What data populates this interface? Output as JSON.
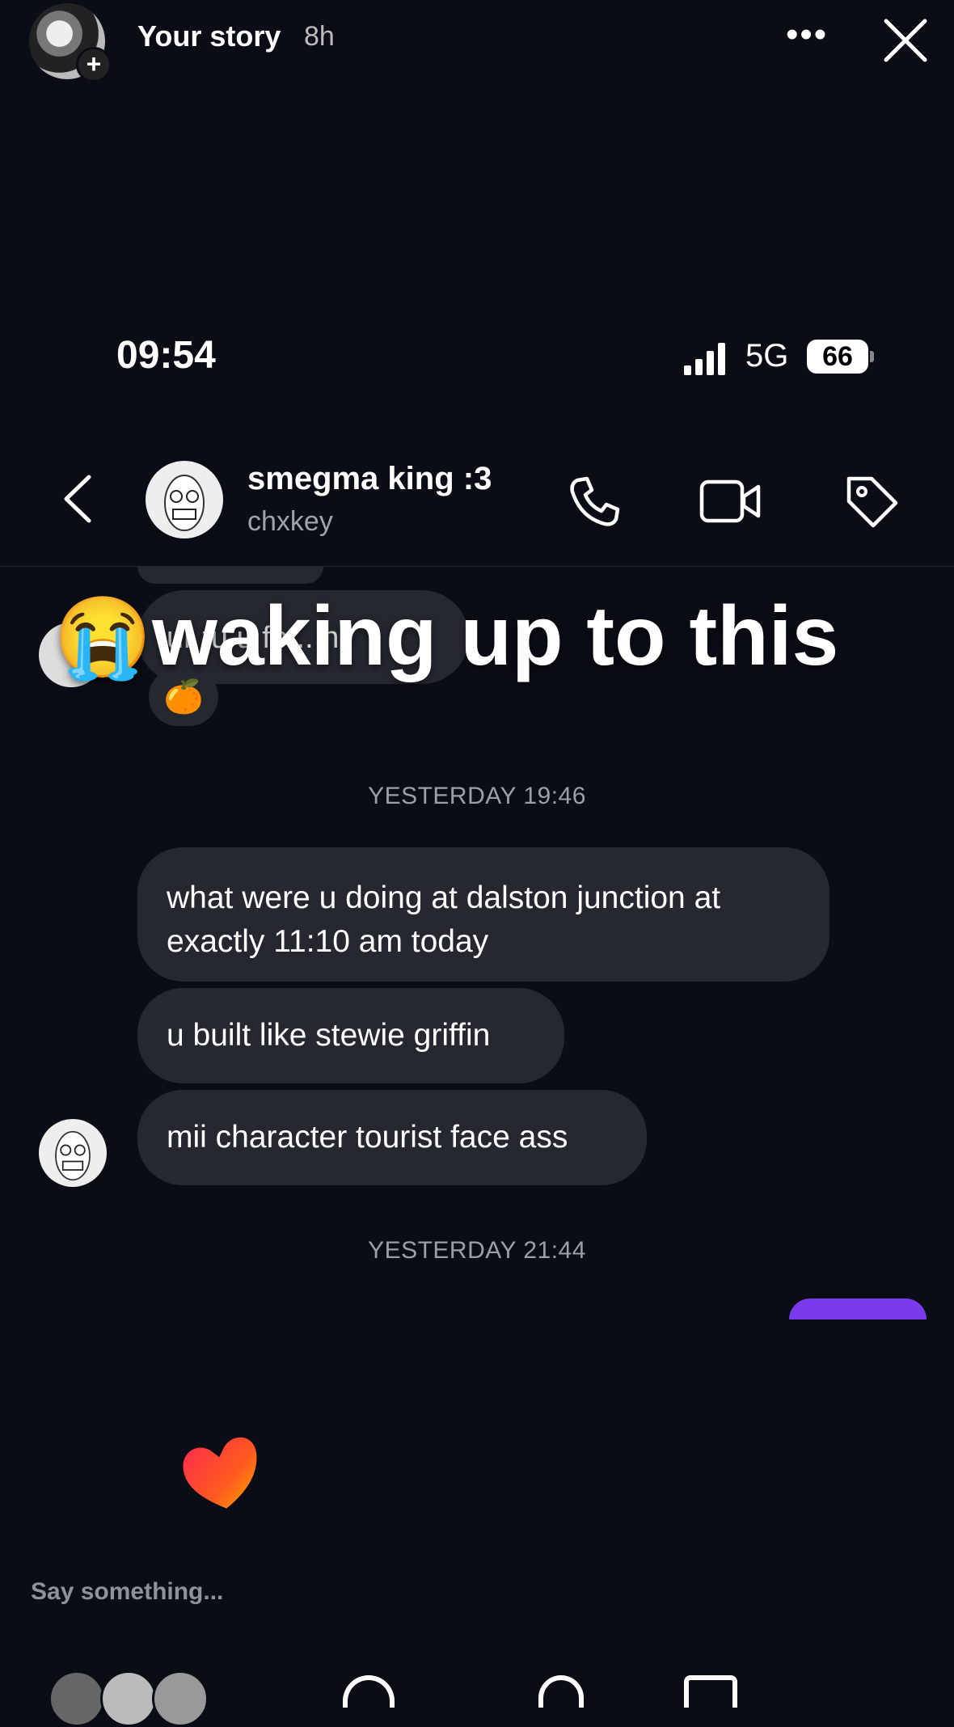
{
  "story": {
    "owner": "Your story",
    "age": "8h",
    "more": "•••"
  },
  "status_bar": {
    "time": "09:54",
    "network": "5G",
    "battery": "66"
  },
  "chat_header": {
    "name": "smegma king :3",
    "username": "chxkey"
  },
  "overlay": {
    "emoji": "😭",
    "text": "waking up to this"
  },
  "earlier": {
    "partial_text": "ur fu u fo... h",
    "reaction": "🍊"
  },
  "timestamps": {
    "first": "YESTERDAY 19:46",
    "second": "YESTERDAY 21:44"
  },
  "messages": [
    {
      "text": "what were u doing at dalston junction at exactly 11:10 am today"
    },
    {
      "text": "u built like stewie griffin"
    },
    {
      "text": "mii character tourist face ass"
    }
  ],
  "reply": {
    "placeholder": "Say something..."
  },
  "colors": {
    "background": "#0b0d16",
    "bubble": "#262830",
    "accent_purple": "#7c3aed",
    "muted_text": "#9c9fa8"
  }
}
